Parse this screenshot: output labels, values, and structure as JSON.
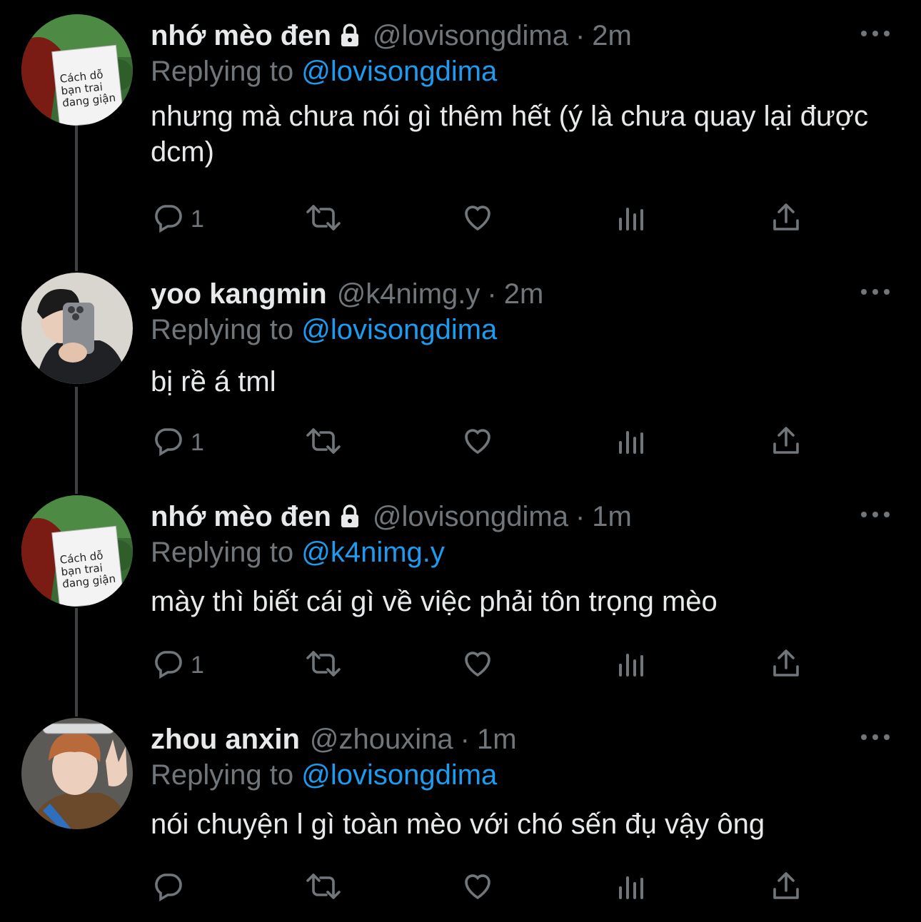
{
  "tweets": [
    {
      "name": "nhớ mèo đen",
      "locked": true,
      "handle": "@lovisongdima",
      "dot": "·",
      "time": "2m",
      "replying_prefix": "Replying to ",
      "replying_to": "@lovisongdima",
      "text": "nhưng mà chưa nói gì thêm hết (ý là chưa quay lại được dcm)",
      "reply_count": "1",
      "avatar": {
        "book_text_1": "Cách dỗ",
        "book_text_2": "bạn trai",
        "book_text_3": "đang giận"
      }
    },
    {
      "name": "yoo kangmin",
      "locked": false,
      "handle": "@k4nimg.y",
      "dot": "·",
      "time": "2m",
      "replying_prefix": "Replying to ",
      "replying_to": "@lovisongdima",
      "text": "bị rề á tml",
      "reply_count": "1"
    },
    {
      "name": "nhớ mèo đen",
      "locked": true,
      "handle": "@lovisongdima",
      "dot": "·",
      "time": "1m",
      "replying_prefix": "Replying to ",
      "replying_to": "@k4nimg.y",
      "text": "mày thì biết cái gì về việc phải tôn trọng mèo",
      "reply_count": "1",
      "avatar": {
        "book_text_1": "Cách dỗ",
        "book_text_2": "bạn trai",
        "book_text_3": "đang giận"
      }
    },
    {
      "name": "zhou anxin",
      "locked": false,
      "handle": "@zhouxina",
      "dot": "·",
      "time": "1m",
      "replying_prefix": "Replying to ",
      "replying_to": "@lovisongdima",
      "text": "nói chuyện l gì toàn mèo với chó sến đụ vậy ông",
      "reply_count": ""
    }
  ],
  "icons": [
    "reply-icon",
    "retweet-icon",
    "like-icon",
    "analytics-icon",
    "share-icon",
    "more-icon",
    "lock-icon"
  ],
  "colors": {
    "background": "#000000",
    "text": "#e7e9ea",
    "secondary": "#71767b",
    "link": "#1d9bf0",
    "thread_line": "#3e4144"
  }
}
